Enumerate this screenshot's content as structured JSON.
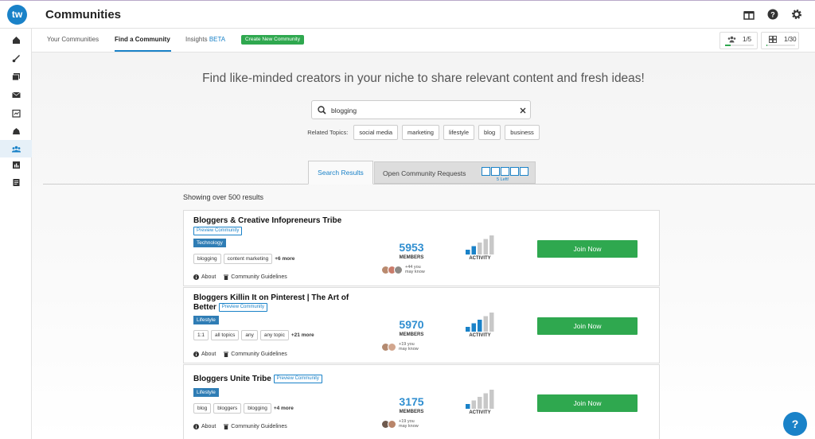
{
  "app": {
    "title": "Communities",
    "logo_text": "tw"
  },
  "subnav": {
    "tabs": [
      {
        "label": "Your Communities"
      },
      {
        "label": "Find a Community"
      },
      {
        "label": "Insights"
      }
    ],
    "beta": "BETA",
    "create_label": "Create New Community",
    "counters": [
      {
        "value": "1/5",
        "icon": "members-icon",
        "fill_fraction": 0.2
      },
      {
        "value": "1/30",
        "icon": "posts-icon",
        "fill_fraction": 0.033
      }
    ]
  },
  "main": {
    "headline": "Find like-minded creators in your niche to share relevant content and fresh ideas!",
    "search_value": "blogging",
    "related_label": "Related Topics:",
    "related_topics": [
      "social media",
      "marketing",
      "lifestyle",
      "blog",
      "business"
    ],
    "tabs": {
      "search": "Search Results",
      "requests": "Open Community Requests",
      "requests_left": "5 Left!"
    },
    "results_count": "Showing over 500 results"
  },
  "cards": [
    {
      "title": "Bloggers & Creative Infopreneurs Tribe",
      "preview": "Preview Community",
      "category": "Technology",
      "topics": [
        "blogging",
        "content marketing"
      ],
      "more": "+6 more",
      "about": "About",
      "guidelines": "Community Guidelines",
      "members": "5953",
      "members_label": "MEMBERS",
      "know_line1": "+44 you",
      "know_line2": "may know",
      "activity_label": "ACTIVITY",
      "activity_level": 2,
      "join": "Join Now"
    },
    {
      "title": "Bloggers Killin It on Pinterest | The Art of Better",
      "preview": "Preview Community",
      "category": "Lifestyle",
      "topics": [
        "1:1",
        "all topics",
        "any",
        "any topic"
      ],
      "more": "+21 more",
      "about": "About",
      "guidelines": "Community Guidelines",
      "members": "5970",
      "members_label": "MEMBERS",
      "know_line1": "+19 you",
      "know_line2": "may know",
      "activity_label": "ACTIVITY",
      "activity_level": 3,
      "join": "Join Now"
    },
    {
      "title": "Bloggers Unite Tribe",
      "preview": "Preview Community",
      "category": "Lifestyle",
      "topics": [
        "blog",
        "bloggers",
        "blogging"
      ],
      "more": "+4 more",
      "about": "About",
      "guidelines": "Community Guidelines",
      "members": "3175",
      "members_label": "MEMBERS",
      "know_line1": "+19 you",
      "know_line2": "may know",
      "activity_label": "ACTIVITY",
      "activity_level": 1,
      "join": "Join Now"
    }
  ],
  "colors": {
    "accent": "#1a82c8",
    "green": "#2fa84f",
    "tag": "#2f7db5"
  },
  "help_label": "?"
}
